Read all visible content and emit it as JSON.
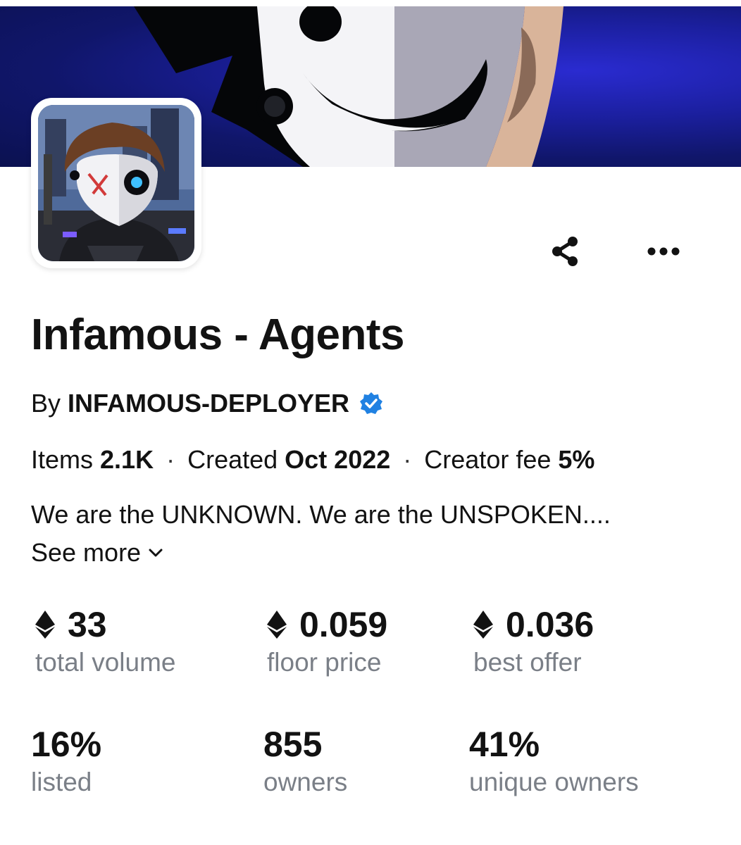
{
  "collection": {
    "name": "Infamous - Agents",
    "by_prefix": "By",
    "creator": "INFAMOUS-DEPLOYER",
    "verified_icon": "verified-badge-icon",
    "accent_color": "#2081e2"
  },
  "meta": {
    "items_label": "Items",
    "items_value": "2.1K",
    "created_label": "Created",
    "created_value": "Oct 2022",
    "fee_label": "Creator fee",
    "fee_value": "5%",
    "separator": "·"
  },
  "description": {
    "text": "We are the UNKNOWN. We are the UNSPOKEN....",
    "see_more_label": "See more"
  },
  "actions": {
    "share_icon": "share-icon",
    "more_icon": "more-options-icon"
  },
  "stats": {
    "total_volume": {
      "value": "33",
      "label": "total volume"
    },
    "floor_price": {
      "value": "0.059",
      "label": "floor price"
    },
    "best_offer": {
      "value": "0.036",
      "label": "best offer"
    },
    "listed": {
      "value": "16%",
      "label": "listed"
    },
    "owners": {
      "value": "855",
      "label": "owners"
    },
    "unique_owners": {
      "value": "41%",
      "label": "unique owners"
    }
  }
}
